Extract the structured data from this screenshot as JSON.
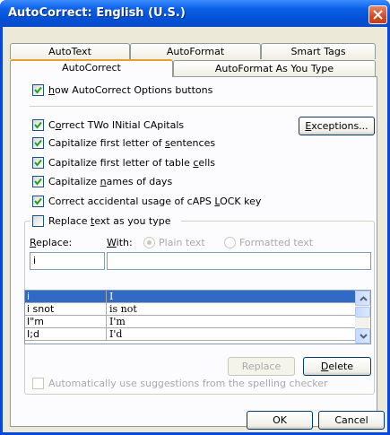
{
  "window": {
    "title": "AutoCorrect: English (U.S.)"
  },
  "tabs": {
    "row1": [
      "AutoText",
      "AutoFormat",
      "Smart Tags"
    ],
    "row2": [
      "AutoCorrect",
      "AutoFormat As You Type"
    ]
  },
  "options": {
    "show_buttons": {
      "pre": "",
      "key": "h",
      "post": "ow AutoCorrect Options buttons",
      "checked": true
    },
    "two_initial": {
      "pre": "C",
      "key": "o",
      "post": "rrect TWo INitial CApitals",
      "checked": true
    },
    "first_sentence": {
      "pre": "Capitalize first letter of ",
      "key": "s",
      "post": "entences",
      "checked": true
    },
    "table_cells": {
      "pre": "Capitalize first letter of table ",
      "key": "c",
      "post": "ells",
      "checked": true
    },
    "days": {
      "pre": "Capitalize ",
      "key": "n",
      "post": "ames of days",
      "checked": true
    },
    "caps_lock": {
      "pre": "Correct accidental usage of cAPS ",
      "key": "L",
      "post": "OCK key",
      "checked": true
    },
    "replace_text": {
      "pre": "Replace ",
      "key": "t",
      "post": "ext as you type",
      "checked": false
    }
  },
  "exceptions_button": {
    "key": "E",
    "post": "xceptions..."
  },
  "replace_section": {
    "replace_label": {
      "key": "R",
      "post": "eplace:"
    },
    "with_label": {
      "key": "W",
      "post": "ith:"
    },
    "plain_text": "Plain text",
    "formatted_text": "Formatted text",
    "replace_value": "i",
    "with_value": ""
  },
  "entries": [
    {
      "replace": "i",
      "with": "I",
      "selected": true
    },
    {
      "replace": "i snot",
      "with": "is not",
      "selected": false
    },
    {
      "replace": "I\"m",
      "with": "I'm",
      "selected": false
    },
    {
      "replace": "I;d",
      "with": "I'd",
      "selected": false
    }
  ],
  "list_buttons": {
    "replace": "Replace",
    "delete_key": "D",
    "delete_post": "elete"
  },
  "spelling_option": "Automatically use suggestions from the spelling checker",
  "footer": {
    "ok": "OK",
    "cancel": "Cancel"
  },
  "colors": {
    "title_bar": "#0a5ee6",
    "face": "#ece9d8",
    "selection": "#316ac5",
    "close": "#d24a24"
  }
}
